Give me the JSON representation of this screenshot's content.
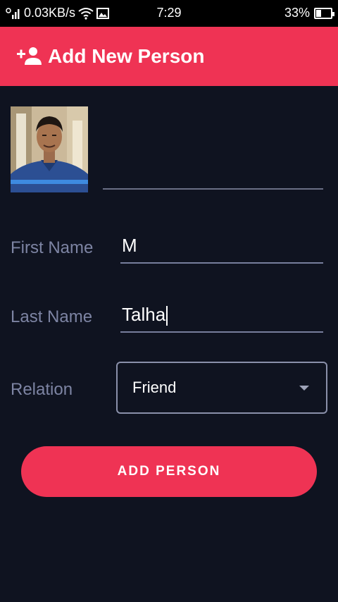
{
  "status_bar": {
    "network_speed": "0.03KB/s",
    "time": "7:29",
    "battery_percent": "33%",
    "battery_level": 0.33
  },
  "app_bar": {
    "title": "Add New Person",
    "icon": "person-add-icon"
  },
  "form": {
    "first_name": {
      "label": "First Name",
      "value": "M"
    },
    "last_name": {
      "label": "Last Name",
      "value": "Talha"
    },
    "relation": {
      "label": "Relation",
      "value": "Friend"
    }
  },
  "submit": {
    "label": "ADD PERSON"
  },
  "colors": {
    "accent": "#ef3354",
    "background": "#0f1320",
    "label": "#7d84a3"
  }
}
